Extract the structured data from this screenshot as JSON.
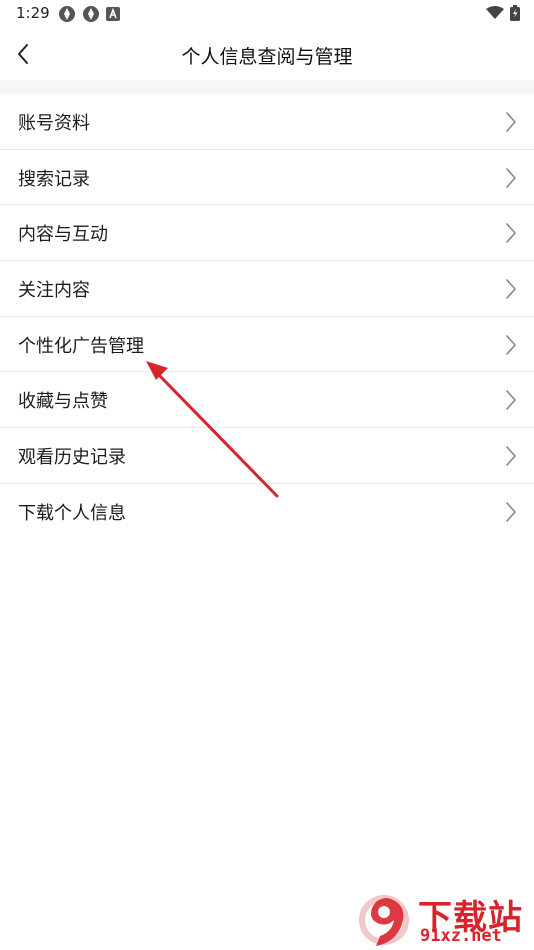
{
  "status_bar": {
    "time": "1:29"
  },
  "nav": {
    "title": "个人信息查阅与管理"
  },
  "menu": {
    "items": [
      {
        "label": "账号资料"
      },
      {
        "label": "搜索记录"
      },
      {
        "label": "内容与互动"
      },
      {
        "label": "关注内容"
      },
      {
        "label": "个性化广告管理"
      },
      {
        "label": "收藏与点赞"
      },
      {
        "label": "观看历史记录"
      },
      {
        "label": "下载个人信息"
      }
    ]
  },
  "watermark": {
    "title": "下载站",
    "url": "91xz.net"
  },
  "colors": {
    "annotation_arrow": "#d7262b",
    "watermark": "#d9232a",
    "divider": "#ececec",
    "section_gap": "#f5f6f8"
  },
  "icons": {
    "back": "chevron-left-icon",
    "row": "chevron-right-icon"
  }
}
